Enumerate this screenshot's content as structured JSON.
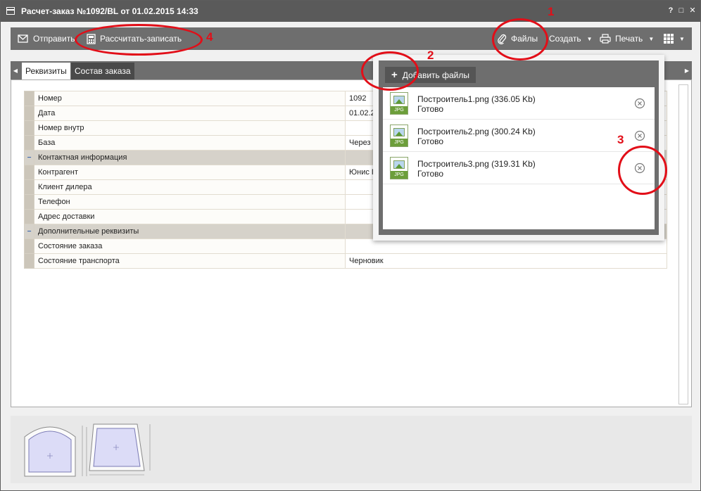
{
  "window": {
    "title": "Расчет-заказ №1092/BL от 01.02.2015 14:33",
    "help": "?",
    "restore": "□",
    "close": "✕"
  },
  "toolbar": {
    "send_label": "Отправить",
    "calc_label": "Рассчитать-записать",
    "files_label": "Файлы",
    "create_label": "Создать",
    "print_label": "Печать"
  },
  "tabs": [
    {
      "label": "Реквизиты"
    },
    {
      "label": "Состав заказа"
    }
  ],
  "grid": {
    "rows": [
      {
        "label": "Номер",
        "value": "1092"
      },
      {
        "label": "Дата",
        "value": "01.02.2"
      },
      {
        "label": "Номер внутр",
        "value": ""
      },
      {
        "label": "База",
        "value": "Через"
      }
    ],
    "group_contact": "Контактная информация",
    "contact_rows": [
      {
        "label": "Контрагент",
        "value": "Юнис Г"
      },
      {
        "label": "Клиент дилера",
        "value": ""
      },
      {
        "label": "Телефон",
        "value": ""
      },
      {
        "label": "Адрес доставки",
        "value": ""
      }
    ],
    "group_extra": "Дополнительные реквизиты",
    "extra_rows": [
      {
        "label": "Состояние заказа",
        "value": ""
      },
      {
        "label": "Состояние транспорта",
        "value": "Черновик"
      }
    ]
  },
  "files_popup": {
    "add_label": "Добавить файлы",
    "files": [
      {
        "name": "Построитель1.png (336.05 Kb)",
        "status": "Готово",
        "ext": "JPG"
      },
      {
        "name": "Построитель2.png (300.24 Kb)",
        "status": "Готово",
        "ext": "JPG"
      },
      {
        "name": "Построитель3.png (319.31 Kb)",
        "status": "Готово",
        "ext": "JPG"
      }
    ]
  },
  "annotations": {
    "n1": "1",
    "n2": "2",
    "n3": "3",
    "n4": "4",
    "color": "#e20e18"
  },
  "colors": {
    "titlebar": "#5a5a5a",
    "toolbar": "#6e6e6e",
    "accent_green": "#6c9e3a"
  }
}
